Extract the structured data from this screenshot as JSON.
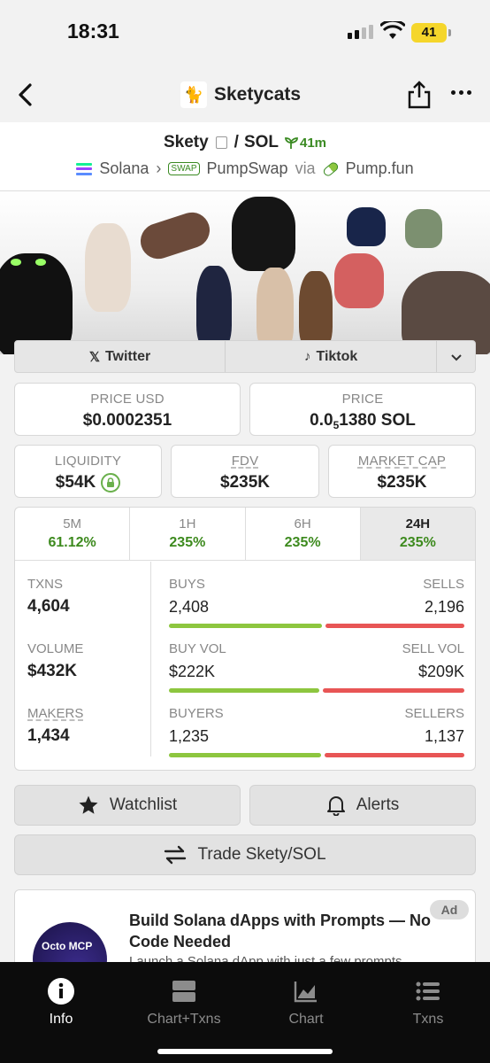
{
  "status_bar": {
    "time": "18:31",
    "battery": "41"
  },
  "header": {
    "title": "Sketycats"
  },
  "pair": {
    "base": "Skety",
    "separator": "/",
    "quote": "SOL",
    "age": "41m",
    "chain": "Solana",
    "dex": "PumpSwap",
    "via": "via",
    "launchpad": "Pump.fun"
  },
  "social": {
    "twitter": "Twitter",
    "tiktok": "Tiktok"
  },
  "price": {
    "usd_label": "PRICE USD",
    "usd_value": "$0.0002351",
    "native_label": "PRICE",
    "native_prefix": "0.0",
    "native_sub": "5",
    "native_suffix": "1380 SOL"
  },
  "metrics": {
    "liquidity_label": "LIQUIDITY",
    "liquidity_value": "$54K",
    "fdv_label": "FDV",
    "fdv_value": "$235K",
    "mcap_label": "MARKET CAP",
    "mcap_value": "$235K"
  },
  "timeframes": [
    {
      "label": "5M",
      "change": "61.12%"
    },
    {
      "label": "1H",
      "change": "235%"
    },
    {
      "label": "6H",
      "change": "235%"
    },
    {
      "label": "24H",
      "change": "235%"
    }
  ],
  "stats": {
    "txns_label": "TXNS",
    "txns_value": "4,604",
    "volume_label": "VOLUME",
    "volume_value": "$432K",
    "makers_label": "MAKERS",
    "makers_value": "1,434",
    "buys_label": "BUYS",
    "buys_value": "2,408",
    "sells_label": "SELLS",
    "sells_value": "2,196",
    "buyvol_label": "BUY VOL",
    "buyvol_value": "$222K",
    "sellvol_label": "SELL VOL",
    "sellvol_value": "$209K",
    "buyers_label": "BUYERS",
    "buyers_value": "1,235",
    "sellers_label": "SELLERS",
    "sellers_value": "1,137",
    "buy_ratio": [
      0.523,
      0.515,
      0.52
    ]
  },
  "actions": {
    "watchlist": "Watchlist",
    "alerts": "Alerts",
    "trade": "Trade Skety/SOL"
  },
  "ad": {
    "badge": "Ad",
    "title": "Build Solana dApps with Prompts — No Code Needed",
    "body": "Launch a Solana dApp with just a few prompts",
    "image_text": "Octo MCP"
  },
  "bottom_nav": [
    {
      "label": "Info",
      "icon": "info-icon"
    },
    {
      "label": "Chart+Txns",
      "icon": "split-icon"
    },
    {
      "label": "Chart",
      "icon": "chart-icon"
    },
    {
      "label": "Txns",
      "icon": "list-icon"
    }
  ],
  "colors": {
    "positive": "#3d8a1e",
    "buy_bar": "#8dc63f",
    "sell_bar": "#e85555",
    "battery": "#f5d62b"
  }
}
